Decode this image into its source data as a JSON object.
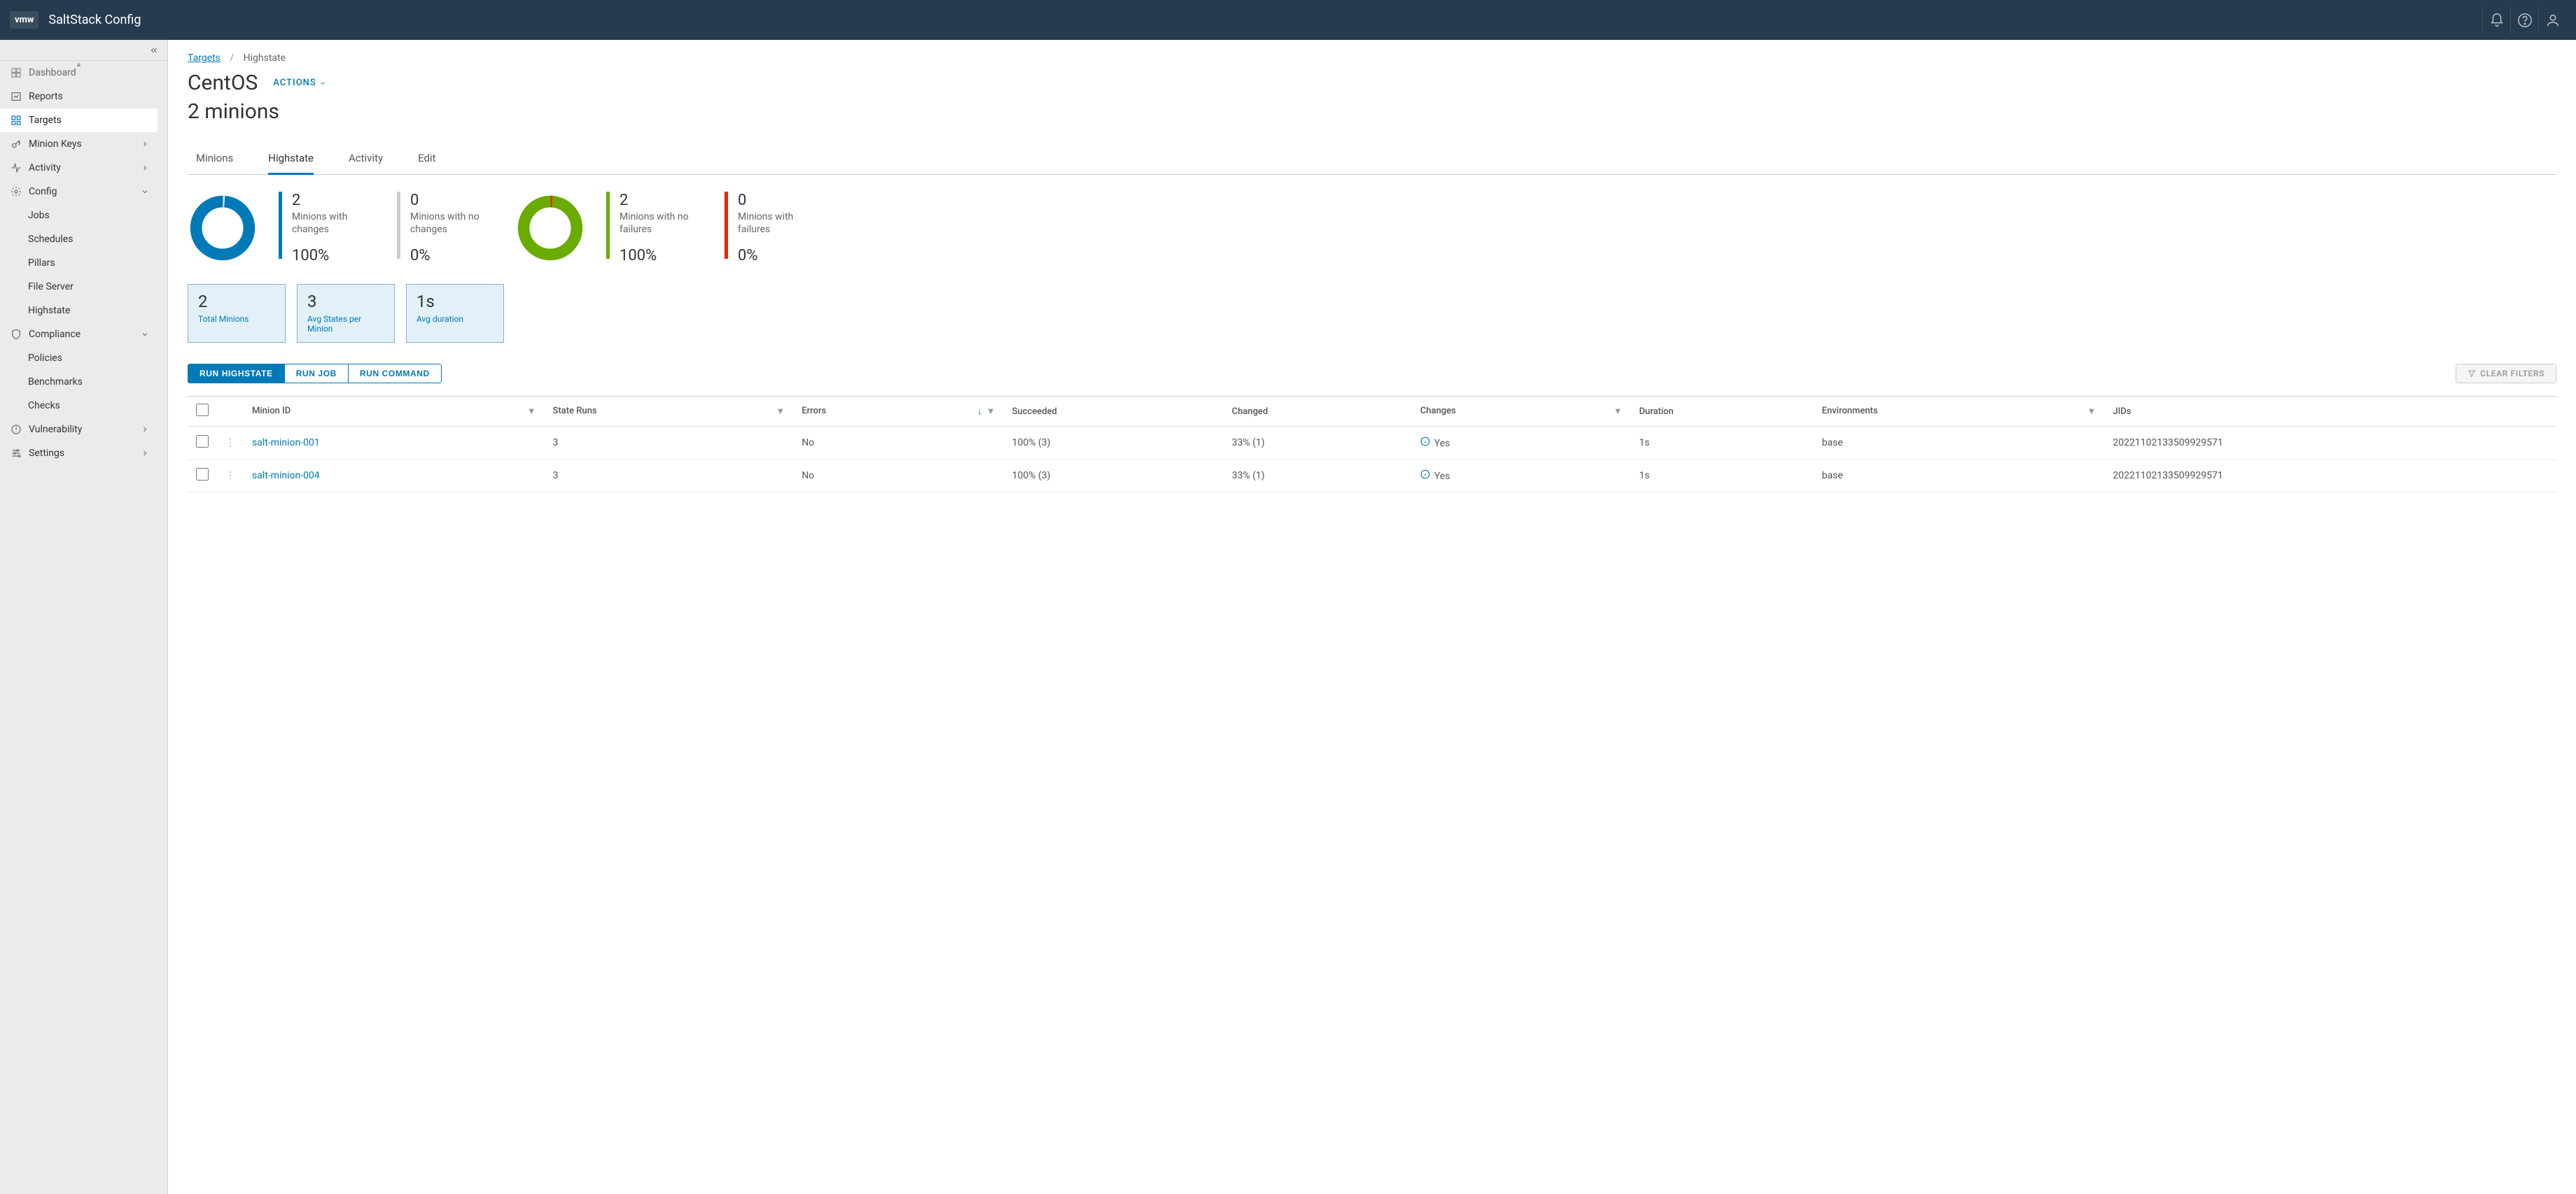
{
  "app": {
    "logo": "vmw",
    "title": "SaltStack Config"
  },
  "sidebar": {
    "items": [
      {
        "label": "Dashboard",
        "icon": "dashboard"
      },
      {
        "label": "Reports",
        "icon": "reports"
      },
      {
        "label": "Targets",
        "icon": "targets",
        "active": true
      },
      {
        "label": "Minion Keys",
        "icon": "keys",
        "expandable": true
      },
      {
        "label": "Activity",
        "icon": "activity",
        "expandable": true
      },
      {
        "label": "Config",
        "icon": "config",
        "expandable": true,
        "expanded": true,
        "children": [
          "Jobs",
          "Schedules",
          "Pillars",
          "File Server",
          "Highstate"
        ]
      },
      {
        "label": "Compliance",
        "icon": "shield",
        "expandable": true,
        "expanded": true,
        "children": [
          "Policies",
          "Benchmarks",
          "Checks"
        ]
      },
      {
        "label": "Vulnerability",
        "icon": "vuln",
        "expandable": true
      },
      {
        "label": "Settings",
        "icon": "settings",
        "expandable": true
      }
    ]
  },
  "breadcrumb": {
    "root": "Targets",
    "current": "Highstate"
  },
  "page": {
    "title": "CentOS",
    "actions_label": "ACTIONS",
    "subtitle": "2 minions"
  },
  "tabs": [
    "Minions",
    "Highstate",
    "Activity",
    "Edit"
  ],
  "active_tab": "Highstate",
  "chart_data": {
    "type": "donut",
    "charts": [
      {
        "name": "changes",
        "series": [
          {
            "name": "Minions with changes",
            "value": 2,
            "pct": "100%",
            "color": "#0079b8"
          },
          {
            "name": "Minions with no changes",
            "value": 0,
            "pct": "0%",
            "color": "#cccccc"
          }
        ]
      },
      {
        "name": "failures",
        "series": [
          {
            "name": "Minions with no failures",
            "value": 2,
            "pct": "100%",
            "color": "#6aab00"
          },
          {
            "name": "Minions with failures",
            "value": 0,
            "pct": "0%",
            "color": "#e62700"
          }
        ]
      }
    ]
  },
  "stats": {
    "changes": {
      "num": "2",
      "label": "Minions with changes",
      "pct": "100%"
    },
    "no_changes": {
      "num": "0",
      "label": "Minions with no changes",
      "pct": "0%"
    },
    "no_failures": {
      "num": "2",
      "label": "Minions with no failures",
      "pct": "100%"
    },
    "failures": {
      "num": "0",
      "label": "Minions with failures",
      "pct": "0%"
    }
  },
  "cards": [
    {
      "num": "2",
      "label": "Total Minions"
    },
    {
      "num": "3",
      "label": "Avg States per Minion"
    },
    {
      "num": "1s",
      "label": "Avg duration"
    }
  ],
  "buttons": {
    "run_highstate": "RUN HIGHSTATE",
    "run_job": "RUN JOB",
    "run_command": "RUN COMMAND",
    "clear_filters": "CLEAR FILTERS"
  },
  "table": {
    "columns": [
      "Minion ID",
      "State Runs",
      "Errors",
      "Succeeded",
      "Changed",
      "Changes",
      "Duration",
      "Environments",
      "JIDs"
    ],
    "rows": [
      {
        "minion_id": "salt-minion-001",
        "state_runs": "3",
        "errors": "No",
        "succeeded": "100% (3)",
        "changed": "33% (1)",
        "changes": "Yes",
        "duration": "1s",
        "environments": "base",
        "jids": "20221102133509929571"
      },
      {
        "minion_id": "salt-minion-004",
        "state_runs": "3",
        "errors": "No",
        "succeeded": "100% (3)",
        "changed": "33% (1)",
        "changes": "Yes",
        "duration": "1s",
        "environments": "base",
        "jids": "20221102133509929571"
      }
    ]
  },
  "colors": {
    "accent": "#0079b8",
    "green": "#6aab00",
    "red": "#e62700",
    "grey": "#cccccc"
  }
}
